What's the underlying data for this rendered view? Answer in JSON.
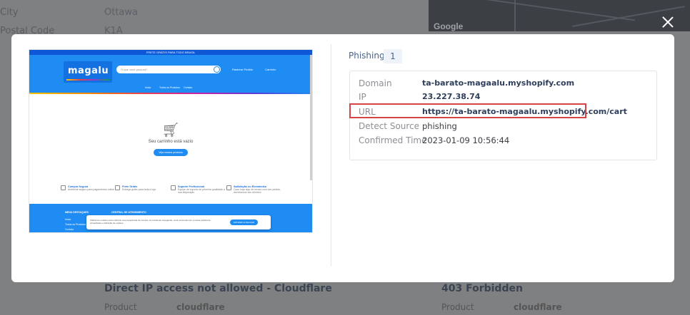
{
  "background": {
    "labels": [
      "City",
      "Postal Code"
    ],
    "values": [
      "Ottawa",
      "K1A"
    ],
    "map_brand": "Google",
    "cards": [
      {
        "title": "Direct IP access not allowed - Cloudflare",
        "label": "Product",
        "value": "cloudflare"
      },
      {
        "title": "403 Forbidden",
        "label": "Product",
        "value": "cloudflare"
      }
    ]
  },
  "modal": {
    "tag_label": "Phishing",
    "tag_count": "1",
    "details": [
      {
        "key": "Domain",
        "value": "ta-barato-magaalu.myshopify.com"
      },
      {
        "key": "IP",
        "value": "23.227.38.74"
      },
      {
        "key": "URL",
        "value": "https://ta-barato-magaalu.myshopify.com/cart"
      },
      {
        "key": "Detect Source",
        "value": "phishing"
      },
      {
        "key": "Confirmed Time",
        "value": "2023-01-09 10:56:44"
      }
    ]
  },
  "screenshot": {
    "topbar": "FRETE GRÁTIS PARA TODO BRASIL",
    "logo": "magalu",
    "search_placeholder": "O que você procura?",
    "header_links": [
      "Rastrear Pedido",
      "Carrinho"
    ],
    "nav": [
      "Início",
      "Todos os Produtos",
      "Contato"
    ],
    "empty_text": "Seu carrinho está vazio",
    "empty_button": "Veja nossos produtos",
    "features": [
      {
        "title": "Compra Segura",
        "text": "Ambiente seguro para pagamentos online"
      },
      {
        "title": "Frete Grátis",
        "text": "Entrega grátis para toda a loja"
      },
      {
        "title": "Suporte Profissional",
        "text": "Equipe de suporte de primeira qualidade a sua disposição"
      },
      {
        "title": "Satisfação ou Reembolso",
        "text": "Caso haja algo de errado com seu pedido, devolvemos seu dinheiro"
      }
    ],
    "footer_cols": [
      "MENU DESTAQUES",
      "CENTRAL DE ATENDIMENTO"
    ],
    "footer_links": [
      "Início",
      "Todos os Produtos",
      "Contato"
    ],
    "cookie_text": "Utilizamos cookies para melhorar sua experiência de compra. Ao continuar navegando, você concorda com a nossa política de privacidade e utilização de cookies.",
    "cookie_button": "ENTENDI E FECHAR"
  },
  "colors": {
    "accent": "#1e8cf3",
    "highlight": "#d64545",
    "link": "#2f3f5b"
  }
}
